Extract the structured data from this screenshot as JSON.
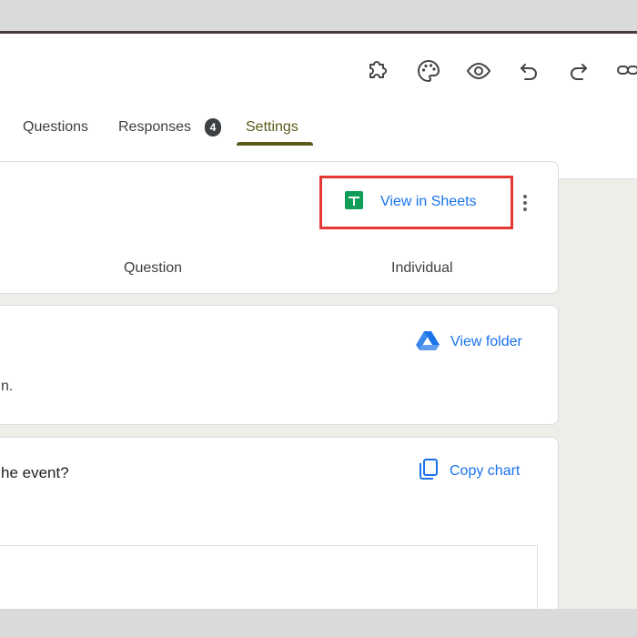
{
  "toolbar": {
    "icons": [
      "addons-icon",
      "palette-icon",
      "eye-icon",
      "undo-icon",
      "redo-icon",
      "link-icon"
    ]
  },
  "tabs": {
    "questions": "Questions",
    "responses": "Responses",
    "responses_count": "4",
    "settings": "Settings",
    "active": "Settings"
  },
  "summary_card": {
    "view_in_sheets": "View in Sheets",
    "col_question": "Question",
    "col_individual": "Individual"
  },
  "folder_card": {
    "view_folder": "View folder",
    "partial_text": "n."
  },
  "chart_card": {
    "question_partial": "he event?",
    "copy_chart": "Copy chart"
  },
  "colors": {
    "accent": "#5a5a1a",
    "link": "#1a73e8",
    "highlight": "#e53935",
    "sheets_green": "#0f9d58"
  }
}
